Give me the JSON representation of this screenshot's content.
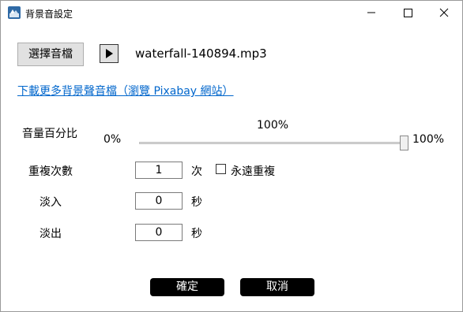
{
  "window": {
    "title": "背景音設定",
    "icon": "app-icon",
    "controls": [
      "minimize-icon",
      "maximize-icon",
      "close-icon"
    ]
  },
  "audio": {
    "choose_button": "選擇音檔",
    "play_icon": "play-icon",
    "filename": "waterfall-140894.mp3"
  },
  "link": {
    "text": "下載更多背景聲音檔（瀏覽 Pixabay 網站）"
  },
  "volume": {
    "label": "音量百分比",
    "min_label": "0%",
    "current_label": "100%",
    "max_label": "100%",
    "value": 100
  },
  "repeat": {
    "label": "重複次數",
    "value": "1",
    "unit": "次",
    "forever_label": "永遠重複",
    "forever_checked": false
  },
  "fade_in": {
    "label": "淡入",
    "value": "0",
    "unit": "秒"
  },
  "fade_out": {
    "label": "淡出",
    "value": "0",
    "unit": "秒"
  },
  "buttons": {
    "ok": "確定",
    "cancel": "取消"
  },
  "colors": {
    "link": "#0066cc",
    "primary_button": "#000000",
    "button_face": "#e1e1e1"
  }
}
